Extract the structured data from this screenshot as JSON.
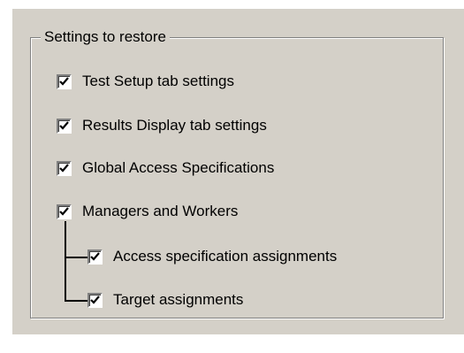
{
  "groupbox": {
    "label": "Settings to restore"
  },
  "options": [
    {
      "label": "Test Setup tab settings",
      "checked": true
    },
    {
      "label": "Results Display tab settings",
      "checked": true
    },
    {
      "label": "Global Access Specifications",
      "checked": true
    },
    {
      "label": "Managers and Workers",
      "checked": true
    },
    {
      "label": "Access specification assignments",
      "checked": true
    },
    {
      "label": "Target assignments",
      "checked": true
    }
  ],
  "icons": {
    "checkmark": "checkmark-icon"
  }
}
